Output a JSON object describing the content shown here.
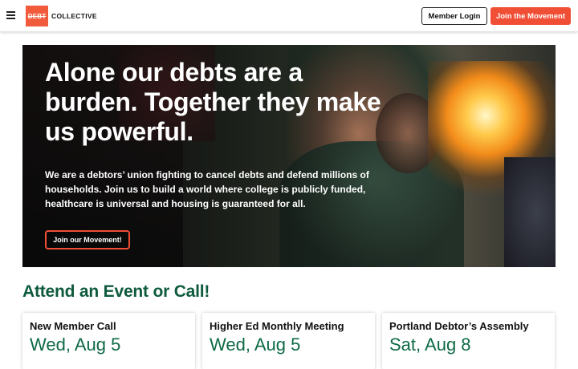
{
  "header": {
    "logo_mark": "DEBT",
    "logo_text": "COLLECTIVE",
    "login_label": "Member Login",
    "join_label": "Join the Movement"
  },
  "hero": {
    "title": "Alone our debts are a burden. Together they make us powerful.",
    "subtitle": "We are a debtors’ union fighting to cancel debts and defend millions of households. Join us to build a world where college is publicly funded, healthcare is universal and housing is guaranteed for all.",
    "button_label": "Join our Movement!"
  },
  "events": {
    "title": "Attend an Event or Call!",
    "items": [
      {
        "name": "New Member Call",
        "date": "Wed, Aug 5"
      },
      {
        "name": "Higher Ed Monthly Meeting",
        "date": "Wed, Aug 5"
      },
      {
        "name": "Portland Debtor’s Assembly",
        "date": "Sat, Aug 8"
      }
    ]
  },
  "colors": {
    "accent": "#f04e35",
    "heading_green": "#0e5a3c"
  }
}
